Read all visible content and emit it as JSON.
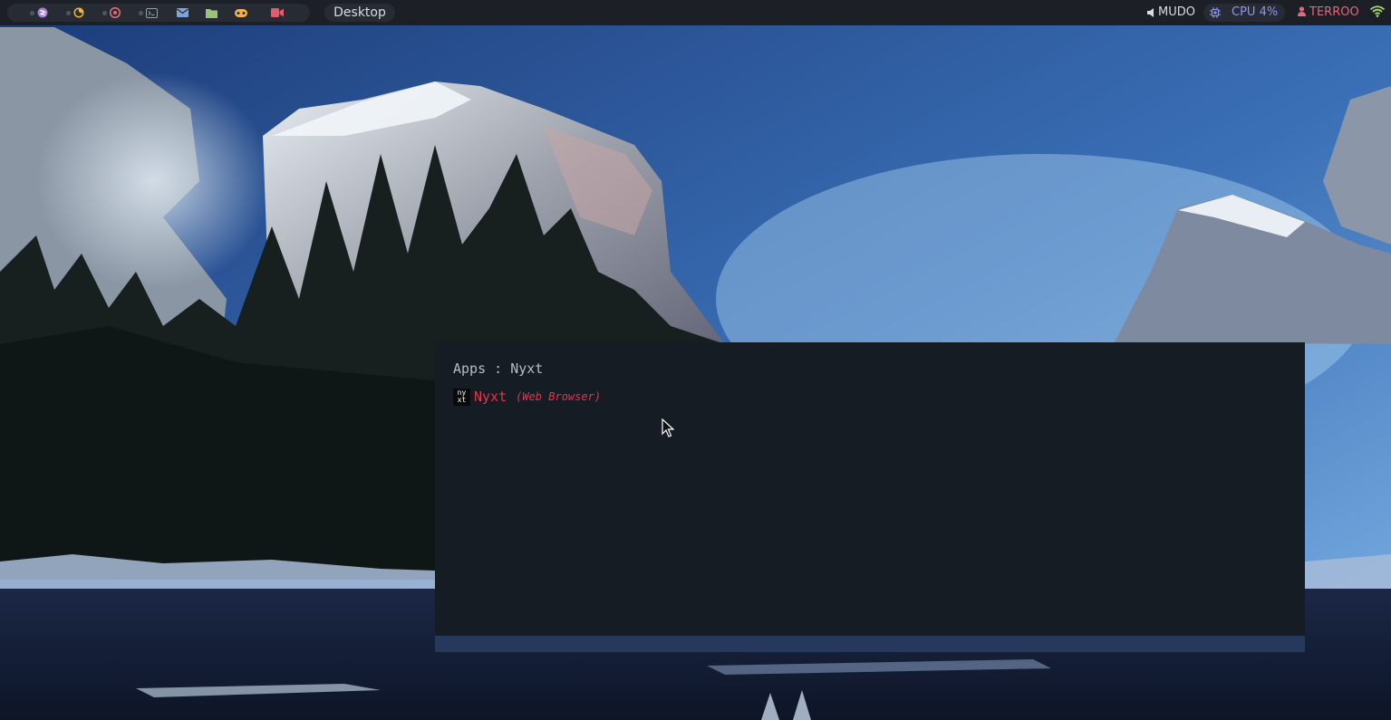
{
  "topbar": {
    "workspaces": [
      {
        "icon": "emacs-icon",
        "color": "#a57de0"
      },
      {
        "icon": "firefox-icon",
        "color": "#f5b52a"
      },
      {
        "icon": "chrome-icon",
        "color": "#e06a7a"
      },
      {
        "icon": "terminal-icon",
        "color": "#8aa5a7"
      },
      {
        "icon": "mail-icon",
        "color": "#7aa6d8"
      },
      {
        "icon": "folder-icon",
        "color": "#9bc07a"
      },
      {
        "icon": "gamepad-icon",
        "color": "#f0b050"
      },
      {
        "icon": "video-icon",
        "color": "#e85a6a"
      }
    ],
    "desktop_label": "Desktop",
    "volume": {
      "icon": "speaker-icon",
      "label": "MUDO"
    },
    "cpu": {
      "icon": "cpu-icon",
      "label": "CPU 4%"
    },
    "user": {
      "icon": "user-icon",
      "label": "TERROO"
    },
    "network": {
      "icon": "wifi-icon",
      "color": "#a8d46f"
    }
  },
  "launcher": {
    "prompt": "Apps : Nyxt",
    "results": [
      {
        "icon_top": "ny",
        "icon_bottom": "xt",
        "name": "Nyxt",
        "description": "(Web Browser)"
      }
    ]
  }
}
